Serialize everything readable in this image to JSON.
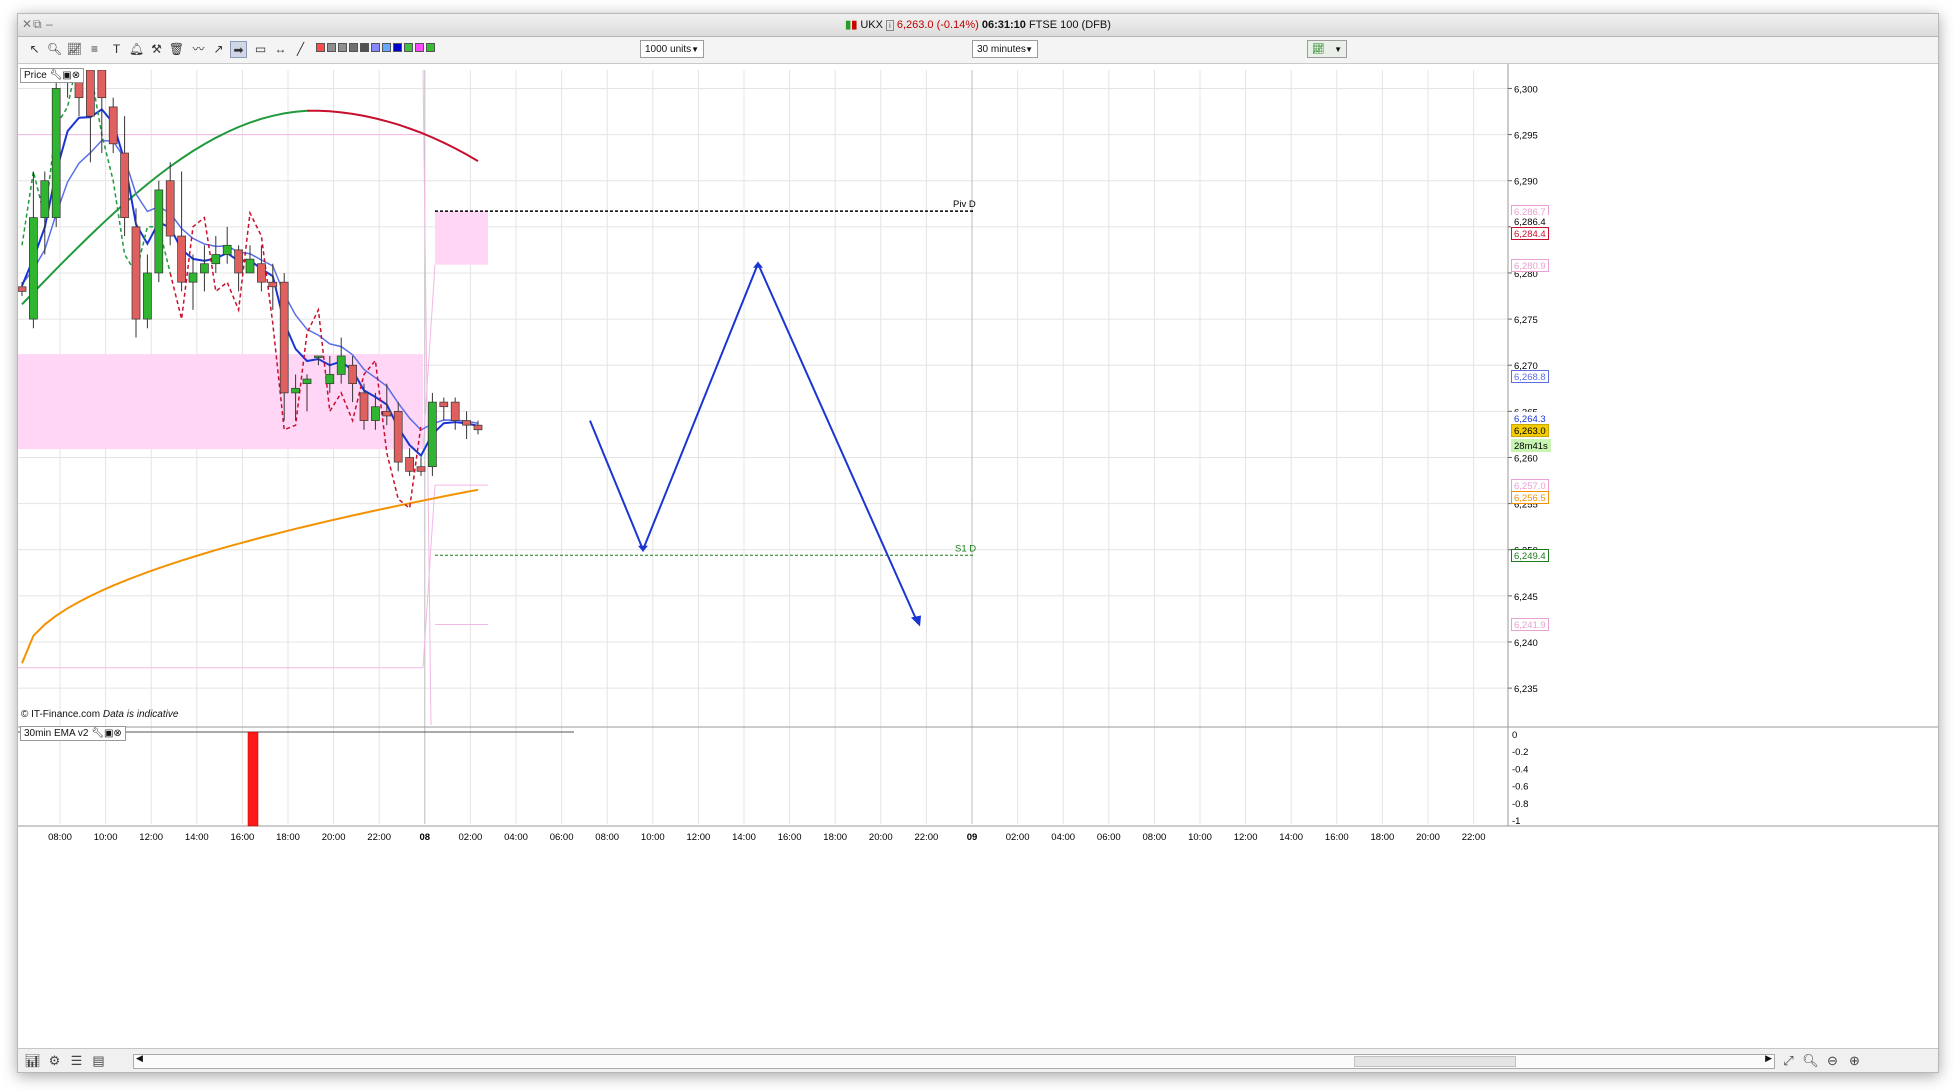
{
  "window": {
    "title_icon": "chart-icon",
    "symbol": "UKX",
    "price_change": "6,263.0 (-0.14%)",
    "time": "06:31:10",
    "instrument": "FTSE 100 (DFB)"
  },
  "toolbar": {
    "units_select": "1000 units",
    "interval_select": "30 minutes"
  },
  "price_panel": {
    "label": "Price",
    "copyright": "© IT-Finance.com",
    "disclaimer": "Data is indicative",
    "y_ticks": [
      "6,300",
      "6,295",
      "6,290",
      "6,285",
      "6,280",
      "6,275",
      "6,270",
      "6,265",
      "6,260",
      "6,255",
      "6,250",
      "6,245",
      "6,240",
      "6,235"
    ],
    "price_labels": [
      {
        "text": "6,286.7",
        "v": 6286.7,
        "fg": "#e9a0d2",
        "bg": "#ffffff",
        "bd": "#e9a0d2"
      },
      {
        "text": "6,286.4",
        "v": 6285.6,
        "fg": "#000000",
        "bg": "#ffffff",
        "bd": "#ffffff"
      },
      {
        "text": "6,284.4",
        "v": 6284.3,
        "fg": "#c8102e",
        "bg": "#ffffff",
        "bd": "#c8102e"
      },
      {
        "text": "6,280.9",
        "v": 6280.9,
        "fg": "#e9a0d2",
        "bg": "#ffffff",
        "bd": "#e9a0d2"
      },
      {
        "text": "6,268.8",
        "v": 6268.8,
        "fg": "#5b6ee8",
        "bg": "#ffffff",
        "bd": "#5b6ee8"
      },
      {
        "text": "6,264.3",
        "v": 6264.3,
        "fg": "#1a35d4",
        "bg": "#ffffff",
        "bd": "#ffffff"
      },
      {
        "text": "6,263.0",
        "v": 6263.0,
        "fg": "#000000",
        "bg": "#f2cc00",
        "bd": "#c9a800"
      },
      {
        "text": "28m41s",
        "v": 6261.4,
        "fg": "#000000",
        "bg": "#c9f5b3",
        "bd": "#c9f5b3"
      },
      {
        "text": "6,257.0",
        "v": 6257.0,
        "fg": "#e9a0d2",
        "bg": "#ffffff",
        "bd": "#e9a0d2"
      },
      {
        "text": "6,256.5",
        "v": 6255.7,
        "fg": "#f39200",
        "bg": "#ffffff",
        "bd": "#f39200"
      },
      {
        "text": "6,249.4",
        "v": 6249.4,
        "fg": "#1a7a1a",
        "bg": "#ffffff",
        "bd": "#1a7a1a"
      },
      {
        "text": "6,241.9",
        "v": 6241.9,
        "fg": "#e9a0d2",
        "bg": "#ffffff",
        "bd": "#e9a0d2"
      }
    ],
    "pivot_label": "Piv D",
    "s1_label": "S1 D"
  },
  "indicator_panel": {
    "label": "30min EMA v2",
    "y_ticks": [
      "0",
      "-0.2",
      "-0.4",
      "-0.6",
      "-0.8",
      "-1"
    ]
  },
  "x_axis": {
    "labels": [
      "08:00",
      "10:00",
      "12:00",
      "14:00",
      "16:00",
      "18:00",
      "20:00",
      "22:00",
      "08",
      "02:00",
      "04:00",
      "06:00",
      "08:00",
      "10:00",
      "12:00",
      "14:00",
      "16:00",
      "18:00",
      "20:00",
      "22:00",
      "09",
      "02:00",
      "04:00",
      "06:00",
      "08:00",
      "10:00",
      "12:00",
      "14:00",
      "16:00",
      "18:00",
      "20:00",
      "22:00"
    ]
  },
  "colors": {
    "up_candle": "#2fb52f",
    "down_candle": "#e06060",
    "ema_fast": "#1a35d4",
    "ema_mid": "#5b6ee8",
    "ema_green": "#1f9a3c",
    "ema_red": "#c8102e",
    "ema_orange": "#f39200",
    "pivot_zone": "#ffd6f5",
    "forecast_arrow": "#1a35d4"
  },
  "chart_data": {
    "type": "candlestick",
    "symbol": "UKX",
    "ylim": [
      6231,
      6302
    ],
    "candles": [
      {
        "o": 6278.5,
        "h": 6279,
        "l": 6277.5,
        "c": 6278
      },
      {
        "o": 6275,
        "h": 6291,
        "l": 6274,
        "c": 6286
      },
      {
        "o": 6286,
        "h": 6291,
        "l": 6282,
        "c": 6290
      },
      {
        "o": 6286,
        "h": 6302,
        "l": 6285,
        "c": 6300
      },
      {
        "o": 6302,
        "h": 6303,
        "l": 6299,
        "c": 6302
      },
      {
        "o": 6302,
        "h": 6303,
        "l": 6297,
        "c": 6299
      },
      {
        "o": 6302,
        "h": 6304,
        "l": 6292,
        "c": 6297
      },
      {
        "o": 6302,
        "h": 6303,
        "l": 6293,
        "c": 6299
      },
      {
        "o": 6298,
        "h": 6299,
        "l": 6293,
        "c": 6294
      },
      {
        "o": 6293,
        "h": 6297,
        "l": 6284,
        "c": 6286
      },
      {
        "o": 6285,
        "h": 6287,
        "l": 6273,
        "c": 6275
      },
      {
        "o": 6275,
        "h": 6282,
        "l": 6274,
        "c": 6280
      },
      {
        "o": 6280,
        "h": 6290,
        "l": 6279,
        "c": 6289
      },
      {
        "o": 6290,
        "h": 6292,
        "l": 6283,
        "c": 6284
      },
      {
        "o": 6284,
        "h": 6291,
        "l": 6278,
        "c": 6279
      },
      {
        "o": 6279,
        "h": 6282,
        "l": 6276,
        "c": 6280
      },
      {
        "o": 6280,
        "h": 6283,
        "l": 6278,
        "c": 6281
      },
      {
        "o": 6281,
        "h": 6284,
        "l": 6280,
        "c": 6282
      },
      {
        "o": 6282,
        "h": 6285,
        "l": 6281,
        "c": 6283
      },
      {
        "o": 6282.5,
        "h": 6283,
        "l": 6278,
        "c": 6280
      },
      {
        "o": 6280,
        "h": 6283,
        "l": 6280,
        "c": 6281.5
      },
      {
        "o": 6281,
        "h": 6283,
        "l": 6278,
        "c": 6279
      },
      {
        "o": 6279,
        "h": 6281,
        "l": 6276,
        "c": 6278.5
      },
      {
        "o": 6279,
        "h": 6280,
        "l": 6264,
        "c": 6267
      },
      {
        "o": 6267,
        "h": 6269,
        "l": 6264,
        "c": 6267.5
      },
      {
        "o": 6268,
        "h": 6269,
        "l": 6265,
        "c": 6268.5
      },
      {
        "o": 6271,
        "h": 6271,
        "l": 6270,
        "c": 6271
      },
      {
        "o": 6268,
        "h": 6271,
        "l": 6267,
        "c": 6269
      },
      {
        "o": 6269,
        "h": 6273,
        "l": 6268,
        "c": 6271
      },
      {
        "o": 6270,
        "h": 6271,
        "l": 6266,
        "c": 6268
      },
      {
        "o": 6267,
        "h": 6268,
        "l": 6263,
        "c": 6264
      },
      {
        "o": 6264,
        "h": 6267,
        "l": 6263,
        "c": 6265.5
      },
      {
        "o": 6265,
        "h": 6268,
        "l": 6263.5,
        "c": 6264.5
      },
      {
        "o": 6265,
        "h": 6266,
        "l": 6258.5,
        "c": 6259.5
      },
      {
        "o": 6260,
        "h": 6261,
        "l": 6258,
        "c": 6258.5
      },
      {
        "o": 6259,
        "h": 6260,
        "l": 6258,
        "c": 6258.5
      },
      {
        "o": 6259,
        "h": 6267,
        "l": 6258,
        "c": 6266
      },
      {
        "o": 6266,
        "h": 6266.5,
        "l": 6264,
        "c": 6265.5
      },
      {
        "o": 6266,
        "h": 6266.5,
        "l": 6263,
        "c": 6264
      },
      {
        "o": 6264,
        "h": 6265,
        "l": 6262,
        "c": 6263.5
      },
      {
        "o": 6263.5,
        "h": 6264,
        "l": 6262.5,
        "c": 6263
      }
    ],
    "levels": {
      "pivot_daily": 6286.7,
      "s1_daily": 6249.4,
      "zone_upper": [
        6286.7,
        6280.9
      ],
      "zone_lower_prev": [
        6271.2,
        6260.9
      ],
      "pink_line_prev_top": 6295,
      "pink_line_prev_bottom": 6237.2,
      "pink_line_upper": 6257.0,
      "pink_line_lower": 6241.9
    },
    "forecast_path": [
      6264,
      6250,
      6281,
      6242
    ],
    "indicator": {
      "name": "30min EMA v2",
      "ylim": [
        -1,
        0
      ],
      "bar_value": -1
    }
  }
}
